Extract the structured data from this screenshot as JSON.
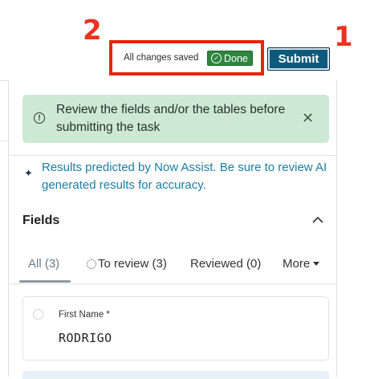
{
  "annotations": {
    "one": "1",
    "two": "2"
  },
  "header": {
    "save_status": "All changes saved",
    "done_badge": "Done",
    "submit_label": "Submit"
  },
  "alert": {
    "text": "Review the fields and/or the tables before submitting the task",
    "close": "✕"
  },
  "assist": {
    "text": "Results predicted by Now Assist. Be sure to review AI generated results for accuracy."
  },
  "fields": {
    "title": "Fields",
    "tabs": {
      "all": "All (3)",
      "review": "To review (3)",
      "reviewed": "Reviewed (0)",
      "more": "More"
    },
    "items": [
      {
        "label": "First Name *",
        "value": "RODRIGO"
      }
    ]
  },
  "colors": {
    "accent": "#0e5a7c",
    "done_green": "#2e8540",
    "alert_bg": "#cde9d4",
    "annotation_red": "#e8240c",
    "link_blue": "#1a7ea6"
  },
  "icons": [
    "check-circle-icon",
    "info-icon",
    "close-icon",
    "sparkle-icon",
    "chevron-up-icon",
    "dotted-circle-icon",
    "caret-down-icon"
  ]
}
